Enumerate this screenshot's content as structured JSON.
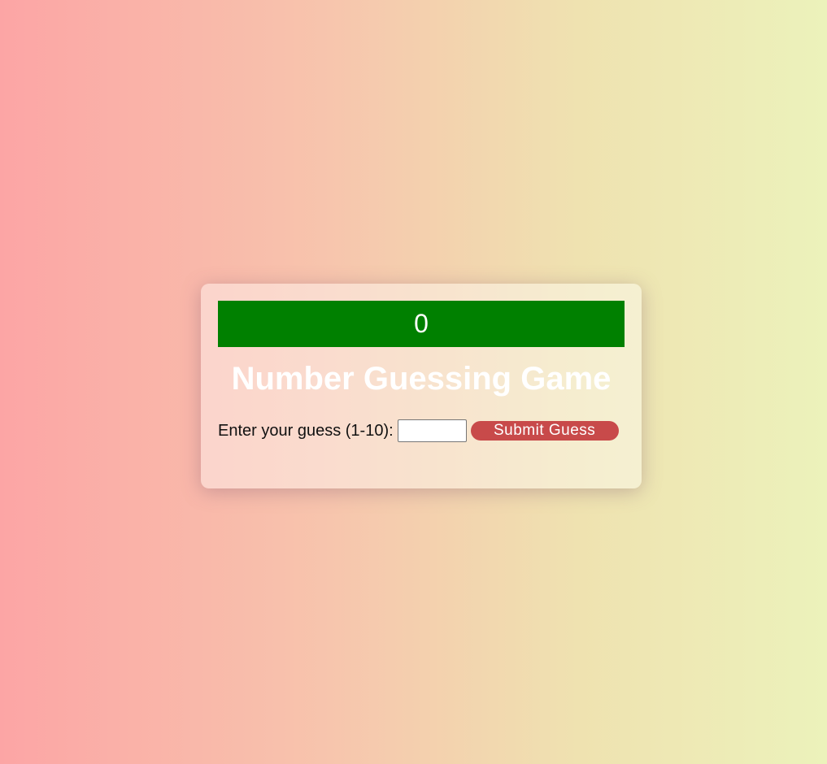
{
  "game": {
    "counter": "0",
    "title": "Number Guessing Game",
    "guess_label": "Enter your guess (1-10):",
    "guess_value": "",
    "submit_label": "Submit Guess"
  },
  "colors": {
    "counter_bg": "#008000",
    "button_bg": "#c84a4a",
    "title_text": "#ffffff"
  }
}
